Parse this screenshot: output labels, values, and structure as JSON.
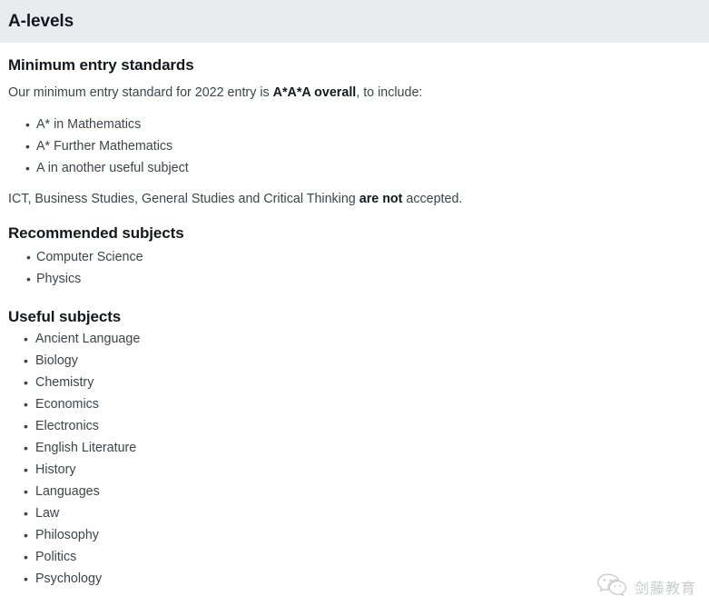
{
  "header": {
    "title": "A-levels",
    "background_color": "#e9ecee",
    "text_color": "#14181c"
  },
  "colors": {
    "heading": "#14181c",
    "body_text": "#3e4449",
    "page_background": "#ffffff",
    "watermark": "#c6c8ca"
  },
  "sections": {
    "minimum_entry": {
      "heading": "Minimum entry standards",
      "intro_before_bold": "Our minimum entry standard for 2022 entry is ",
      "intro_bold": "A*A*A overall",
      "intro_after_bold": ", to include:",
      "requirements": [
        "A* in Mathematics",
        "A* Further Mathematics",
        "A in another useful subject"
      ],
      "exclusion_before_bold": "ICT, Business Studies, General Studies and Critical Thinking ",
      "exclusion_bold": "are not",
      "exclusion_after_bold": " accepted."
    },
    "recommended": {
      "heading": "Recommended subjects",
      "subjects": [
        "Computer Science",
        "Physics"
      ]
    },
    "useful": {
      "heading": "Useful subjects",
      "subjects": [
        "Ancient Language",
        "Biology",
        "Chemistry",
        "Economics",
        "Electronics",
        "English Literature",
        "History",
        "Languages",
        "Law",
        "Philosophy",
        "Politics",
        "Psychology"
      ]
    }
  },
  "watermark": {
    "icon": "wechat-icon",
    "text": "剑藤教育"
  }
}
